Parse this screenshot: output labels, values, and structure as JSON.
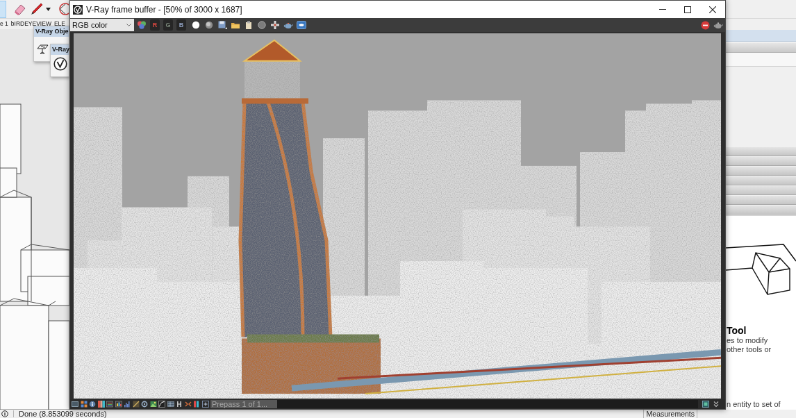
{
  "scene_tabs": [
    {
      "label": "e 1"
    },
    {
      "label": "bIRDEYEVIEW"
    },
    {
      "label": "ELE"
    }
  ],
  "floating_toolbars": [
    {
      "title": "V-Ray Obje"
    },
    {
      "title": "V-Ray"
    }
  ],
  "frame_buffer": {
    "title": "V-Ray frame buffer - [50% of 3000 x 1687]",
    "display_channel": "RGB color",
    "channel_buttons": [
      {
        "label": "R",
        "color": "#d9473f"
      },
      {
        "label": "G",
        "color": "#7d8a7d"
      },
      {
        "label": "B",
        "color": "#8fa0c0"
      }
    ],
    "progress": {
      "text": "Prepass 1 of 1...",
      "level": 0.137
    }
  },
  "instructor": {
    "heading": "Tool",
    "lines": [
      "es to modify",
      "other tools or",
      "n entity to set of"
    ]
  },
  "status_bar": {
    "message": "Done (8.853099 seconds)",
    "measurements_label": "Measurements"
  }
}
